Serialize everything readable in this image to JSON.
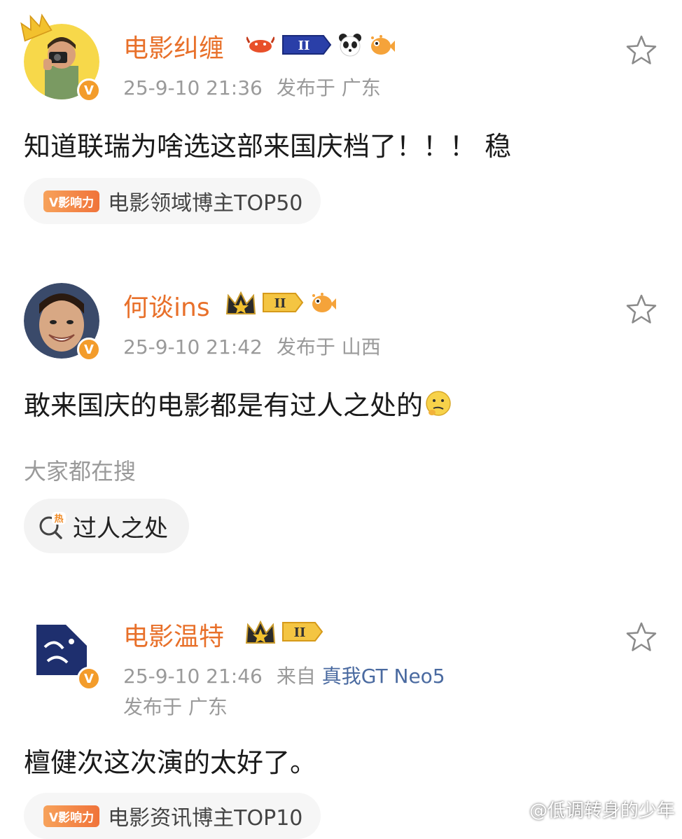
{
  "posts": [
    {
      "username": "电影纠缠",
      "timestamp": "25-9-10 21:36",
      "location": "发布于 广东",
      "content": "知道联瑞为啥选这部来国庆档了！！！ 稳",
      "influence_tag": "V影响力",
      "influence_label": "电影领域博主TOP50",
      "verified_mark": "V",
      "level_badge": "II",
      "icons": [
        "crown-avatar-icon",
        "lobster-icon",
        "level-badge-icon",
        "panda-icon",
        "pufferfish-icon",
        "star-outline-icon"
      ]
    },
    {
      "username": "何谈ins",
      "timestamp": "25-9-10 21:42",
      "location": "发布于 山西",
      "content": "敢来国庆的电影都是有过人之处的",
      "verified_mark": "V",
      "level_badge": "II",
      "icons": [
        "gold-crown-icon",
        "level-badge-icon",
        "pufferfish-icon",
        "thinking-emoji-icon",
        "star-outline-icon"
      ]
    },
    {
      "username": "电影温特",
      "timestamp": "25-9-10 21:46",
      "source_prefix": "来自",
      "device": "真我GT Neo5",
      "location": "发布于 广东",
      "content": "檀健次这次演的太好了。",
      "influence_tag": "V影响力",
      "influence_label": "电影资讯博主TOP10",
      "verified_mark": "V",
      "level_badge": "II",
      "icons": [
        "gold-crown-icon",
        "level-badge-icon",
        "star-outline-icon"
      ]
    }
  ],
  "search": {
    "heading": "大家都在搜",
    "hot_tag": "热",
    "query": "过人之处"
  },
  "watermark": "@低调转身的少年",
  "colors": {
    "username": "#e8702a",
    "meta": "#9a9a9a",
    "device": "#4a6aa0",
    "verified": "#f39c2b",
    "chip_bg": "#f6f6f6"
  }
}
